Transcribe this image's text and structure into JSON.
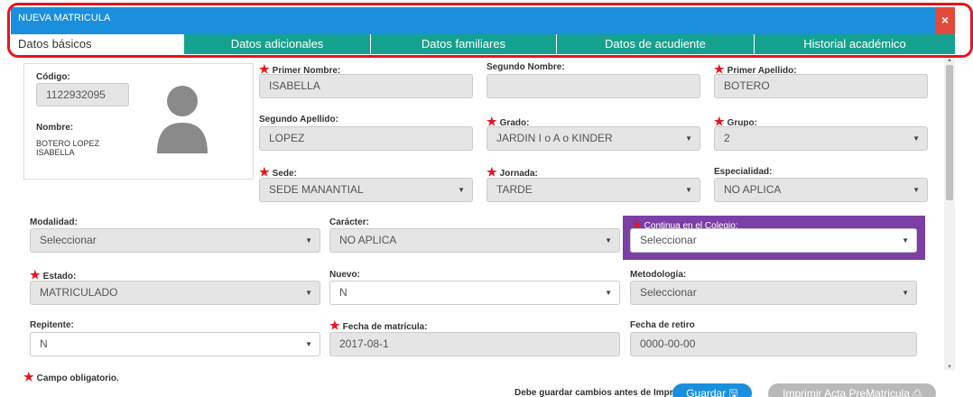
{
  "window": {
    "title": "NUEVA MATRICULA",
    "close_glyph": "×"
  },
  "tabs": [
    {
      "label": "Datos básicos",
      "active": true
    },
    {
      "label": "Datos adicionales"
    },
    {
      "label": "Datos familiares"
    },
    {
      "label": "Datos de acudiente"
    },
    {
      "label": "Historial académico"
    }
  ],
  "student": {
    "codigo_label": "Código:",
    "codigo_value": "1122932095",
    "nombre_label": "Nombre:",
    "nombre_line1": "BOTERO LOPEZ",
    "nombre_line2": "ISABELLA"
  },
  "fields": {
    "primer_nombre": {
      "label": "Primer Nombre:",
      "value": "ISABELLA"
    },
    "segundo_nombre": {
      "label": "Segundo Nombre:",
      "value": ""
    },
    "primer_apellido": {
      "label": "Primer Apellido:",
      "value": "BOTERO"
    },
    "segundo_apellido": {
      "label": "Segundo Apellido:",
      "value": "LOPEZ"
    },
    "grado": {
      "label": "Grado:",
      "value": "JARDIN I o A o KINDER"
    },
    "grupo": {
      "label": "Grupo:",
      "value": "2"
    },
    "sede": {
      "label": "Sede:",
      "value": "SEDE MANANTIAL"
    },
    "jornada": {
      "label": "Jornada:",
      "value": "TARDE"
    },
    "especialidad": {
      "label": "Especialidad:",
      "value": "NO APLICA"
    },
    "modalidad": {
      "label": "Modalidad:",
      "value": "Seleccionar"
    },
    "caracter": {
      "label": "Carácter:",
      "value": "NO APLICA"
    },
    "continua": {
      "label": "Continua en el Colegio:",
      "value": "Seleccionar"
    },
    "estado": {
      "label": "Estado:",
      "value": "MATRICULADO"
    },
    "nuevo": {
      "label": "Nuevo:",
      "value": "N"
    },
    "metodologia": {
      "label": "Metodología:",
      "value": "Seleccionar"
    },
    "repitente": {
      "label": "Repitente:",
      "value": "N"
    },
    "fecha_matricula": {
      "label": "Fecha de matrícula:",
      "value": "2017-08-1"
    },
    "fecha_retiro": {
      "label": "Fecha de retiro",
      "value": "0000-00-00"
    }
  },
  "required_star": "★",
  "footer": {
    "required_note": "Campo obligatorio.",
    "message": "Debe guardar cambios antes de Imprimir.",
    "save_label": "Guardar 🖫",
    "print_label": "Imprimir Acta PreMatricula ⎙"
  },
  "icons": {
    "avatar": "user-avatar-icon",
    "close": "close-icon",
    "dropdown": "caret-down-icon"
  },
  "colors": {
    "header": "#1a8fde",
    "tabs": "#15a190",
    "close": "#e14a3b",
    "highlight": "#7b3fa6",
    "required": "#e8141e"
  }
}
